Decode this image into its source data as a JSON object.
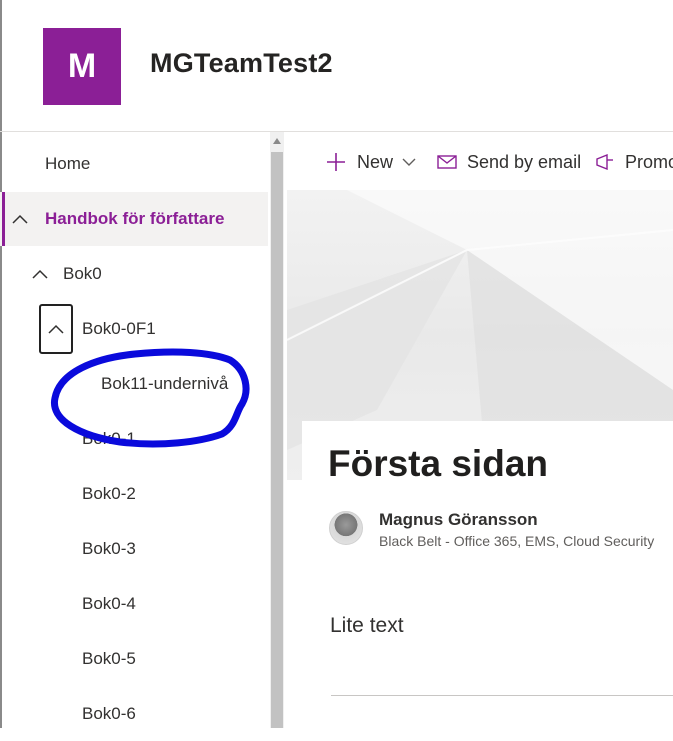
{
  "site": {
    "logo_letter": "M",
    "title": "MGTeamTest2",
    "brand_color": "#8b1f96"
  },
  "nav": {
    "items": [
      {
        "label": "Home"
      },
      {
        "label": "Handbok för författare",
        "icon": "chevron-up-icon",
        "active": true
      },
      {
        "label": "Bok0",
        "icon": "chevron-up-icon"
      },
      {
        "label": "Bok0-0F1",
        "icon": "chevron-up-icon",
        "focused": true
      },
      {
        "label": "Bok11-undernivå"
      },
      {
        "label": "Bok0-1"
      },
      {
        "label": "Bok0-2"
      },
      {
        "label": "Bok0-3"
      },
      {
        "label": "Bok0-4"
      },
      {
        "label": "Bok0-5"
      },
      {
        "label": "Bok0-6"
      }
    ]
  },
  "commandbar": {
    "new_label": "New",
    "send_label": "Send by email",
    "promote_label": "Promo"
  },
  "page": {
    "title": "Första sidan",
    "author_name": "Magnus Göransson",
    "author_title": "Black Belt - Office 365, EMS, Cloud Security",
    "body_text": "Lite text"
  },
  "annotation": {
    "color": "#0a0adc",
    "shape": "hand-drawn circle around Bok11-undernivå"
  }
}
